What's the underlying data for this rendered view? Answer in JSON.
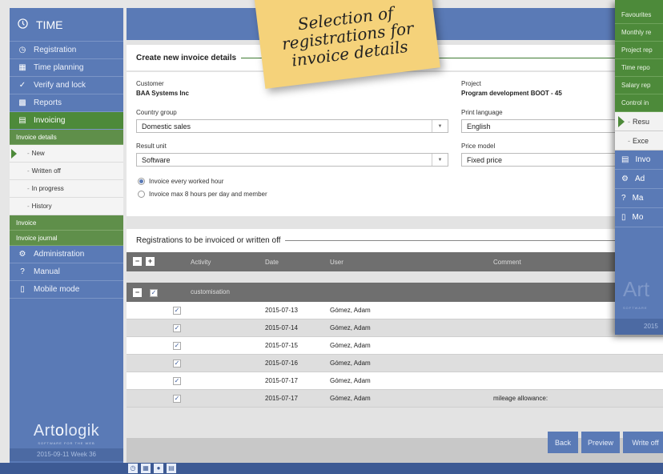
{
  "sidebar": {
    "brand": "TIME",
    "items": [
      {
        "label": "Registration",
        "icon": "clock-plus-icon"
      },
      {
        "label": "Time planning",
        "icon": "calendar-icon"
      },
      {
        "label": "Verify and lock",
        "icon": "check-icon"
      },
      {
        "label": "Reports",
        "icon": "bar-chart-icon"
      },
      {
        "label": "Invoicing",
        "icon": "calculator-icon"
      }
    ],
    "invoice_details": "Invoice details",
    "sub_items": [
      "New",
      "Written off",
      "In progress",
      "History"
    ],
    "invoice": "Invoice",
    "invoice_journal": "Invoice journal",
    "lower_items": [
      {
        "label": "Administration",
        "icon": "gears-icon"
      },
      {
        "label": "Manual",
        "icon": "help-icon"
      },
      {
        "label": "Mobile mode",
        "icon": "phone-icon"
      }
    ],
    "logo_a": "Art",
    "logo_b": "o",
    "logo_c": "logik",
    "logo_sub": "SOFTWARE FOR THE WEB",
    "date": "2015-09-11  Week 36"
  },
  "form": {
    "title": "Create new invoice details",
    "customer_label": "Customer",
    "customer_value": "BAA Systems Inc",
    "project_label": "Project",
    "project_value": "Program development BOOT - 45",
    "country_label": "Country group",
    "country_value": "Domestic sales",
    "print_lang_label": "Print language",
    "print_lang_value": "English",
    "result_unit_label": "Result unit",
    "result_unit_value": "Software",
    "price_model_label": "Price model",
    "price_model_value": "Fixed price",
    "radio1": "Invoice every worked hour",
    "radio2": "Invoice max 8 hours per day and member"
  },
  "grid": {
    "title": "Registrations to be invoiced or written off",
    "headers": {
      "activity": "Activity",
      "date": "Date",
      "user": "User",
      "comment": "Comment"
    },
    "group": "customisation",
    "rows": [
      {
        "date": "2015-07-13",
        "user": "Gómez, Adam",
        "comment": ""
      },
      {
        "date": "2015-07-14",
        "user": "Gómez, Adam",
        "comment": ""
      },
      {
        "date": "2015-07-15",
        "user": "Gómez, Adam",
        "comment": ""
      },
      {
        "date": "2015-07-16",
        "user": "Gómez, Adam",
        "comment": ""
      },
      {
        "date": "2015-07-17",
        "user": "Gómez, Adam",
        "comment": ""
      },
      {
        "date": "2015-07-17",
        "user": "Gómez, Adam",
        "comment": "mileage allowance:"
      }
    ]
  },
  "buttons": {
    "back": "Back",
    "preview": "Preview",
    "write_off": "Write off"
  },
  "overlay": {
    "green_items": [
      "Favourites",
      "Monthly re",
      "Project rep",
      "Time repo",
      "Salary rep",
      "Control in"
    ],
    "sub_items": [
      "Resu",
      "Exce"
    ],
    "blue_items": [
      {
        "label": "Invo",
        "icon": "calculator-icon"
      },
      {
        "label": "Ad",
        "icon": "gears-icon"
      },
      {
        "label": "Ma",
        "icon": "help-icon"
      },
      {
        "label": "Mo",
        "icon": "phone-icon"
      }
    ],
    "logo": "Art",
    "logo_sub": "SOFTWARE",
    "date": "2015"
  },
  "sticky": {
    "text": "Selection of\nregistrations for\ninvoice details"
  },
  "colors": {
    "blue": "#5a7ab6",
    "green": "#4d8a3a",
    "sticky": "#f5d27a"
  }
}
